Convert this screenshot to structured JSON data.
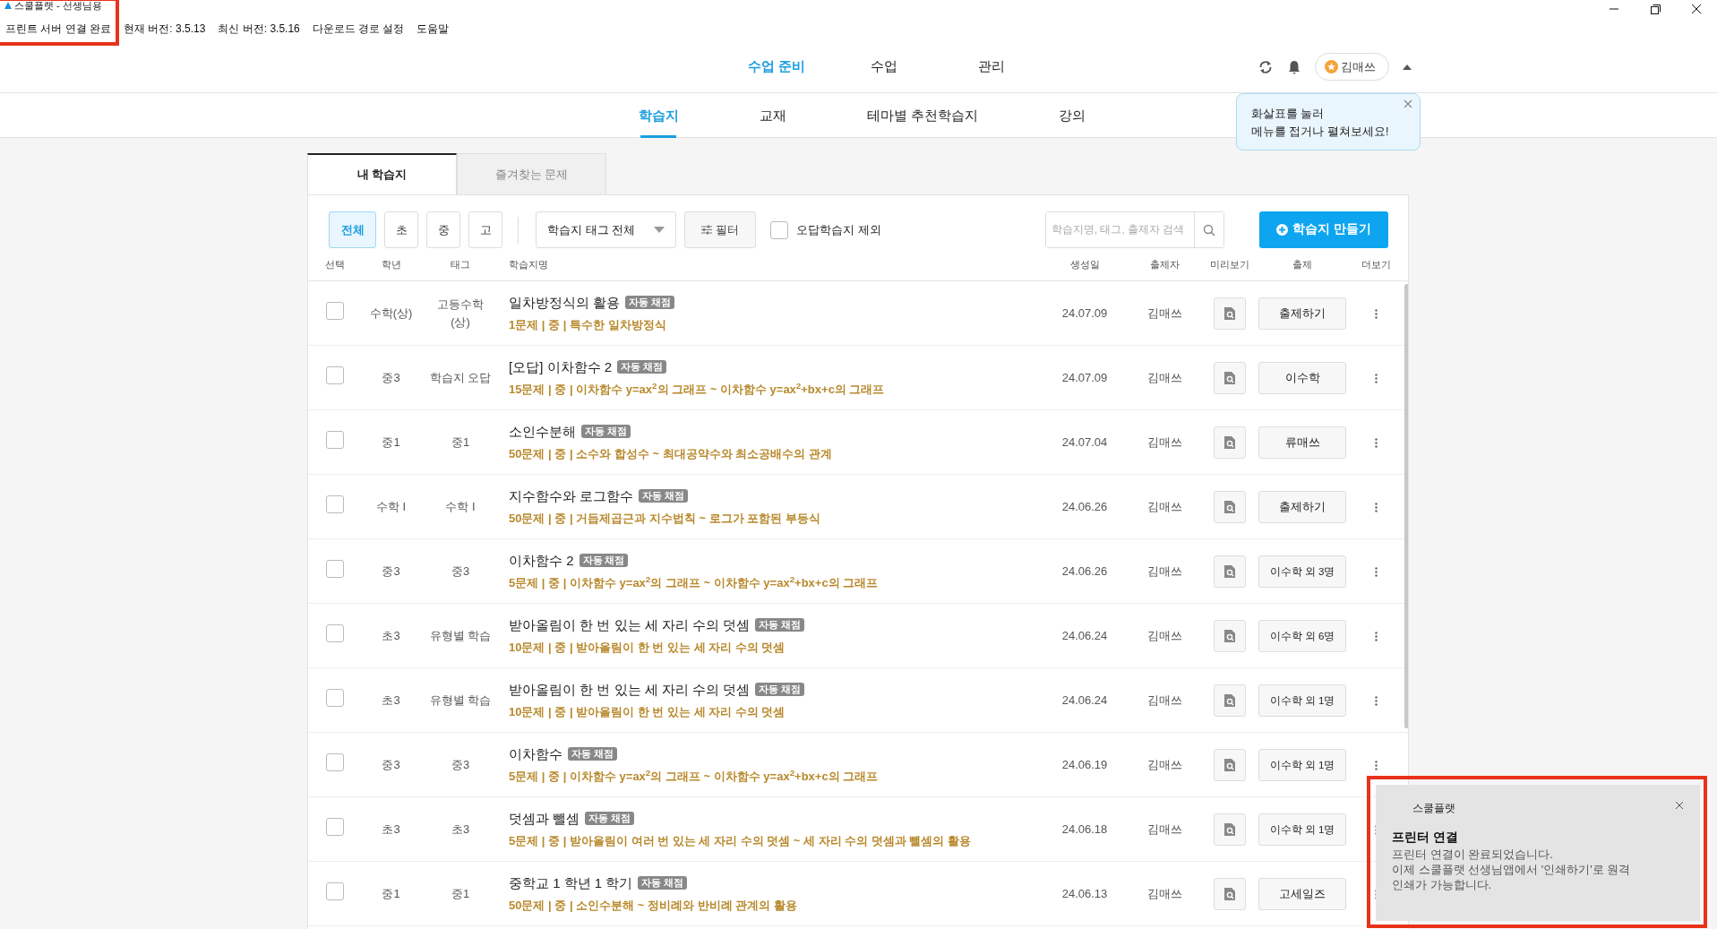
{
  "window": {
    "title": "스쿨플랫 - 선생님용"
  },
  "menu": [
    {
      "label": "프린트 서버 연결 완료",
      "highlighted": true
    },
    {
      "label": "현재 버전: 3.5.13",
      "highlighted": false
    },
    {
      "label": "최신 버전: 3.5.16",
      "highlighted": false
    },
    {
      "label": "다운로드 경로 설정",
      "highlighted": false
    },
    {
      "label": "도움말",
      "highlighted": false
    }
  ],
  "main_nav": [
    {
      "label": "수업 준비",
      "selected": true
    },
    {
      "label": "수업",
      "selected": false
    },
    {
      "label": "관리",
      "selected": false
    }
  ],
  "user": {
    "name": "김매쓰"
  },
  "sub_nav": [
    {
      "label": "학습지",
      "selected": true
    },
    {
      "label": "교재",
      "selected": false
    },
    {
      "label": "테마별 추천학습지",
      "selected": false
    },
    {
      "label": "강의",
      "selected": false
    }
  ],
  "tooltip": {
    "text": "화살표를 눌러\n메뉴를 접거나 펼쳐보세요!"
  },
  "content_tabs": [
    {
      "label": "내 학습지",
      "selected": true
    },
    {
      "label": "즐겨찾는 문제",
      "selected": false
    }
  ],
  "level_filters": [
    {
      "label": "전체",
      "selected": true
    },
    {
      "label": "초",
      "selected": false
    },
    {
      "label": "중",
      "selected": false
    },
    {
      "label": "고",
      "selected": false
    }
  ],
  "tag_dropdown": {
    "value": "학습지 태그 전체"
  },
  "filter_button": "필터",
  "exclude_wrong": {
    "label": "오답학습지 제외",
    "checked": false
  },
  "search": {
    "placeholder": "학습지명, 태그, 출제자 검색"
  },
  "create_button": "학습지 만들기",
  "table": {
    "columns": [
      "선택",
      "학년",
      "태그",
      "학습지명",
      "생성일",
      "출제자",
      "미리보기",
      "출제",
      "더보기"
    ],
    "rows": [
      {
        "checked": false,
        "grade": "수학(상)",
        "tag": "고등수학\n(상)",
        "title": "일차방정식의 활용",
        "badge": "자동 채점",
        "detail": "1문제 | 중 | 특수한 일차방정식",
        "date": "24.07.09",
        "author": "김매쓰",
        "assign": "출제하기"
      },
      {
        "checked": false,
        "grade": "중3",
        "tag": "학습지 오답",
        "title": "[오답] 이차함수 2",
        "badge": "자동 채점",
        "detail": "15문제 | 중 | 이차함수 y=ax$^{2}$의 그래프 ~ 이차함수 y=ax$^{2}$+bx+c의 그래프",
        "date": "24.07.09",
        "author": "김매쓰",
        "assign": "이수학"
      },
      {
        "checked": false,
        "grade": "중1",
        "tag": "중1",
        "title": "소인수분해",
        "badge": "자동 채점",
        "detail": "50문제 | 중 | 소수와 합성수 ~ 최대공약수와 최소공배수의 관계",
        "date": "24.07.04",
        "author": "김매쓰",
        "assign": "류매쓰"
      },
      {
        "checked": false,
        "grade": "수학 I",
        "tag": "수학 I",
        "title": "지수함수와 로그함수",
        "badge": "자동 채점",
        "detail": "50문제 | 중 | 거듭제곱근과 지수법칙 ~ 로그가 포함된 부등식",
        "date": "24.06.26",
        "author": "김매쓰",
        "assign": "출제하기"
      },
      {
        "checked": false,
        "grade": "중3",
        "tag": "중3",
        "title": "이차함수 2",
        "badge": "자동 채점",
        "detail": "5문제 | 중 | 이차함수 y=ax$^{2}$의 그래프 ~ 이차함수 y=ax$^{2}$+bx+c의 그래프",
        "date": "24.06.26",
        "author": "김매쓰",
        "assign": "이수학 외 3명"
      },
      {
        "checked": false,
        "grade": "초3",
        "tag": "유형별 학습",
        "title": "받아올림이 한 번 있는 세 자리 수의 덧셈",
        "badge": "자동 채점",
        "detail": "10문제 | 중 | 받아올림이 한 번 있는 세 자리 수의 덧셈",
        "date": "24.06.24",
        "author": "김매쓰",
        "assign": "이수학 외 6명"
      },
      {
        "checked": false,
        "grade": "초3",
        "tag": "유형별 학습",
        "title": "받아올림이 한 번 있는 세 자리 수의 덧셈",
        "badge": "자동 채점",
        "detail": "10문제 | 중 | 받아올림이 한 번 있는 세 자리 수의 덧셈",
        "date": "24.06.24",
        "author": "김매쓰",
        "assign": "이수학 외 1명"
      },
      {
        "checked": false,
        "grade": "중3",
        "tag": "중3",
        "title": "이차함수",
        "badge": "자동 채점",
        "detail": "5문제 | 중 | 이차함수 y=ax$^{2}$의 그래프 ~ 이차함수 y=ax$^{2}$+bx+c의 그래프",
        "date": "24.06.19",
        "author": "김매쓰",
        "assign": "이수학 외 1명"
      },
      {
        "checked": false,
        "grade": "초3",
        "tag": "초3",
        "title": "덧셈과 뺄셈",
        "badge": "자동 채점",
        "detail": "5문제 | 중 | 받아올림이 여러 번 있는 세 자리 수의 덧셈 ~ 세 자리 수의 덧셈과 뺄셈의 활용",
        "date": "24.06.18",
        "author": "김매쓰",
        "assign": "이수학 외 1명"
      },
      {
        "checked": false,
        "grade": "중1",
        "tag": "중1",
        "title": "중학교 1 학년 1 학기",
        "badge": "자동 채점",
        "detail": "50문제 | 중 | 소인수분해 ~ 정비례와 반비례 관계의 활용",
        "date": "24.06.13",
        "author": "김매쓰",
        "assign": "고세일즈"
      }
    ]
  },
  "notification": {
    "app": "스쿨플랫",
    "title": "프린터 연결",
    "message": "프린터 연결이 완료되었습니다.\n이제 스쿨플랫 선생님앱에서 '인쇄하기'로 원격\n인쇄가 가능합니다.",
    "highlighted": true
  }
}
